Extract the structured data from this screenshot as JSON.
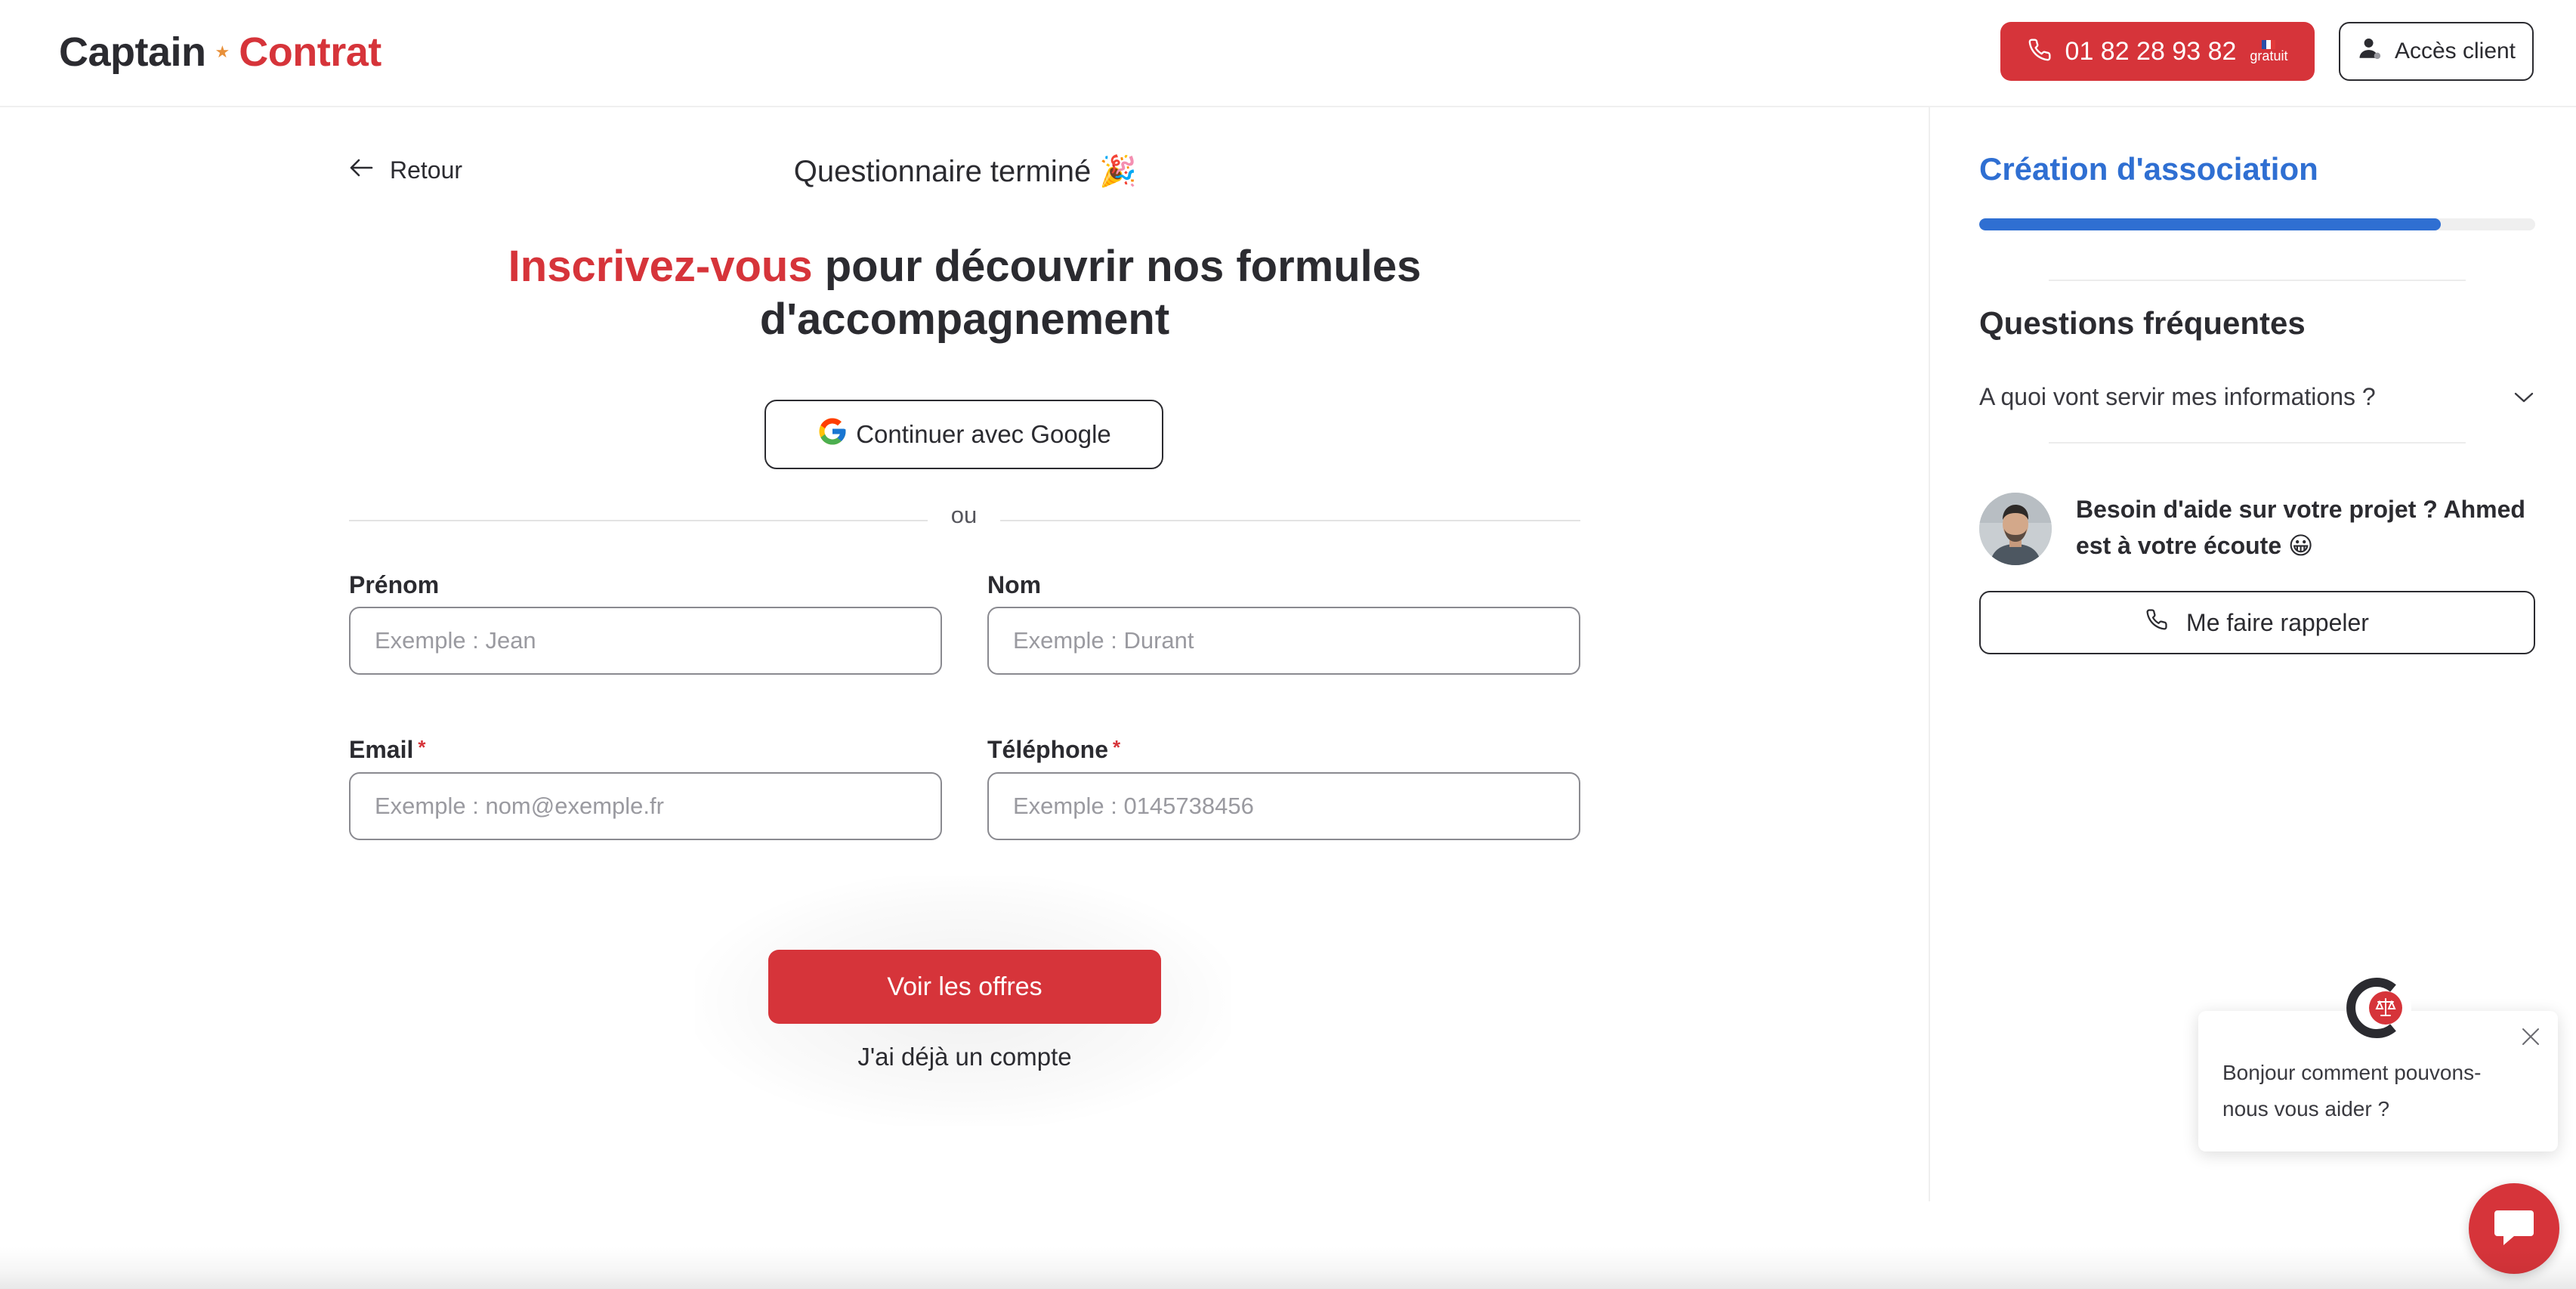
{
  "colors": {
    "brand_red": "#d6343a",
    "accent_blue": "#2f6fd2",
    "text_dark": "#2b2b30"
  },
  "header": {
    "logo_part1": "Captain",
    "logo_star": "★",
    "logo_part2": "Contrat",
    "phone_number": "01 82 28 93 82",
    "phone_badge": "gratuit",
    "client_access_label": "Accès client",
    "icons": [
      "phone-icon",
      "france-flag-icon",
      "user-icon"
    ]
  },
  "main": {
    "back_label": "Retour",
    "quiz_status": "Questionnaire terminé 🎉",
    "headline_highlight": "Inscrivez-vous",
    "headline_rest": " pour découvrir nos formules d'accompagnement",
    "google_button_label": "Continuer avec Google",
    "separator_label": "ou",
    "form": {
      "first_name": {
        "label": "Prénom",
        "placeholder": "Exemple : Jean",
        "value": ""
      },
      "last_name": {
        "label": "Nom",
        "placeholder": "Exemple : Durant",
        "value": ""
      },
      "email": {
        "label": "Email",
        "required_mark": "*",
        "placeholder": "Exemple : nom@exemple.fr",
        "value": ""
      },
      "phone": {
        "label": "Téléphone",
        "required_mark": "*",
        "placeholder": "Exemple : 0145738456",
        "value": ""
      }
    },
    "submit_label": "Voir les offres",
    "existing_account_label": "J'ai déjà un compte"
  },
  "sidebar": {
    "title": "Création d'association",
    "progress_fraction": 0.83,
    "faq_title": "Questions fréquentes",
    "faq_items": [
      {
        "question": "A quoi vont servir mes informations ?",
        "expanded": false
      }
    ],
    "help_text": "Besoin d'aide sur votre projet ? Ahmed est à votre écoute 😀",
    "callback_label": "Me faire rappeler"
  },
  "chat": {
    "message": "Bonjour comment pouvons-nous vous aider ?",
    "icons": [
      "close-icon",
      "chat-bubble-icon",
      "scales-icon"
    ]
  }
}
